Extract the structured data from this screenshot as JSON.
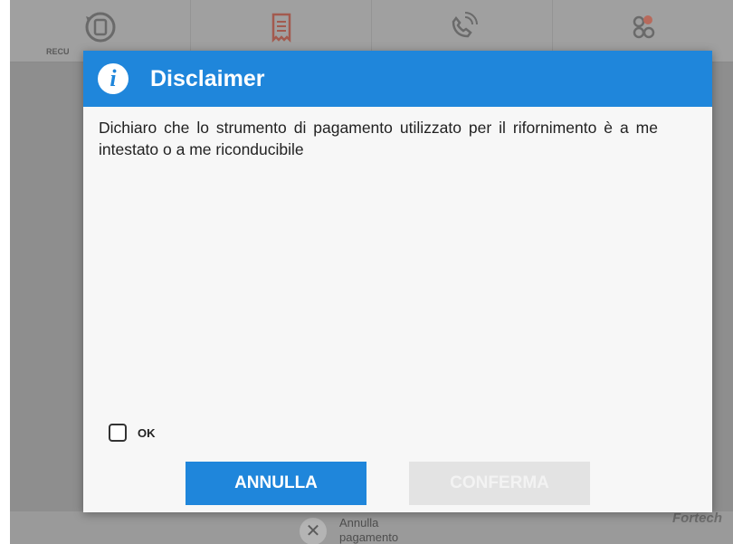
{
  "background": {
    "toolbar": {
      "first_tool_label": "RECU",
      "tools": [
        {
          "icon": "recharge-icon"
        },
        {
          "icon": "receipt-icon"
        },
        {
          "icon": "phone-call-icon"
        },
        {
          "icon": "coins-icon"
        }
      ]
    },
    "cancel_payment": {
      "label": "Annulla pagamento",
      "icon": "close-icon"
    },
    "brand": "Fortech"
  },
  "dialog": {
    "title": "Disclaimer",
    "icon": "info-icon",
    "icon_glyph": "i",
    "body": "Dichiaro che lo strumento di pagamento utilizzato per il rifornimento è a me intestato o a me riconducibile",
    "checkbox": {
      "label": "OK",
      "checked": false
    },
    "buttons": {
      "cancel": "ANNULLA",
      "confirm": "CONFERMA"
    }
  },
  "colors": {
    "accent": "#1f86db",
    "overlay": "#8e8e8e",
    "disabled_button": "#e3e3e3"
  }
}
